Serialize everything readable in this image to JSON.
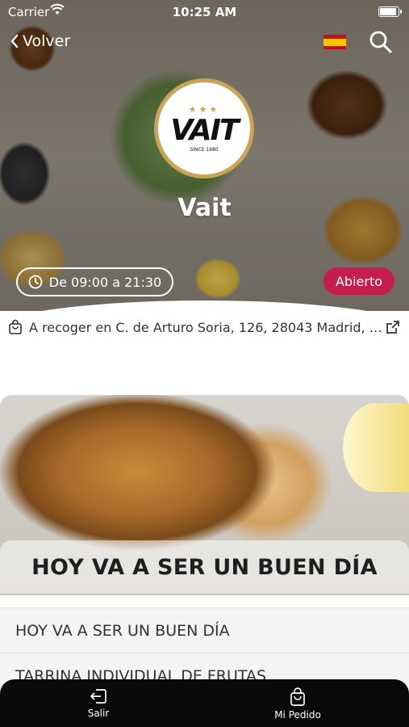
{
  "status_bar": {
    "carrier": "Carrier",
    "time": "10:25 AM",
    "battery_level": 0.9
  },
  "header": {
    "back_label": "Volver",
    "language_flag": "spain-flag-icon",
    "search_icon": "search-icon"
  },
  "store": {
    "logo_text": "VAIT",
    "logo_since": "SINCE 1980",
    "logo_stars": "★★★",
    "name": "Vait",
    "hours": "De 09:00 a 21:30",
    "status": "Abierto",
    "pickup": "A recoger en C. de Arturo Soria, 126, 28043 Madrid, Es..."
  },
  "category": {
    "title": "HOY VA A SER UN BUEN DÍA"
  },
  "items": [
    {
      "label": "HOY VA A SER UN BUEN DÍA"
    },
    {
      "label": "TARRINA INDIVIDUAL DE FRUTAS"
    }
  ],
  "tab_bar": {
    "exit_label": "Salir",
    "order_label": "Mi Pedido"
  },
  "colors": {
    "badge_open": "#c41e4e",
    "logo_gold": "#c9a35a",
    "tab_bar": "#0a0a0a"
  }
}
